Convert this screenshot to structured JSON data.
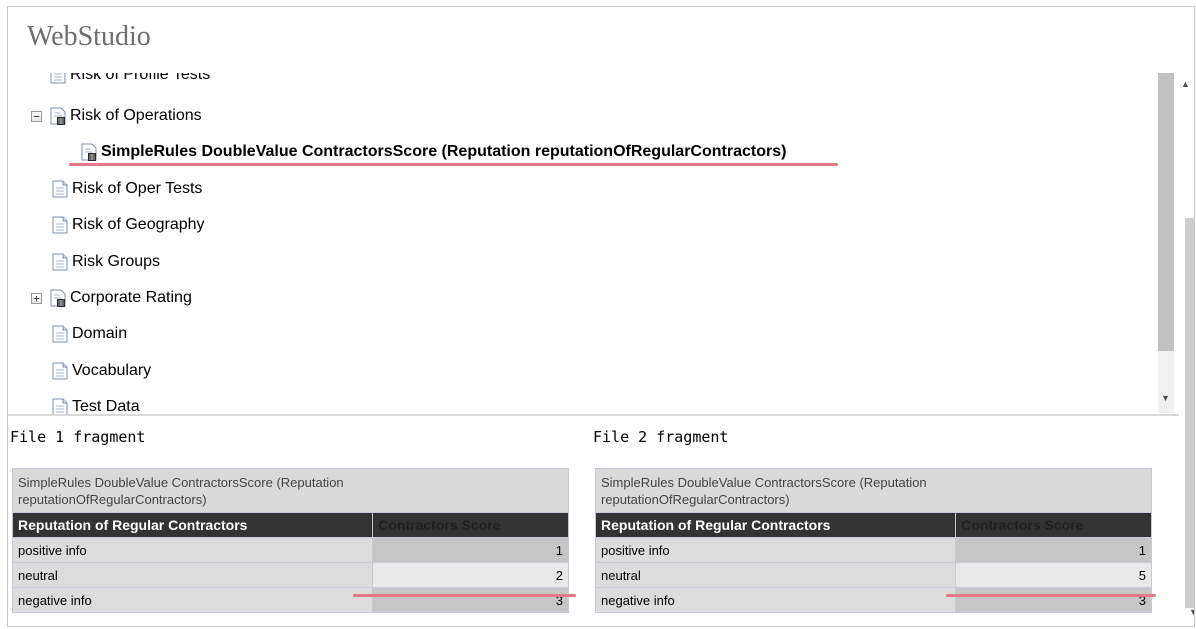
{
  "app": {
    "title": "WebStudio"
  },
  "tree": {
    "items": [
      {
        "label": "Risk of Profile Tests",
        "icon": "document-icon",
        "toggle": null
      },
      {
        "label": "Risk of Operations",
        "icon": "table-document-icon",
        "toggle": "−"
      },
      {
        "label": "SimpleRules DoubleValue ContractorsScore (Reputation reputationOfRegularContractors)",
        "icon": "table-document-icon",
        "toggle": null,
        "selected": true
      },
      {
        "label": "Risk of Oper Tests",
        "icon": "document-icon",
        "toggle": null
      },
      {
        "label": "Risk of Geography",
        "icon": "document-icon",
        "toggle": null
      },
      {
        "label": "Risk Groups",
        "icon": "document-icon",
        "toggle": null
      },
      {
        "label": "Corporate Rating",
        "icon": "table-document-icon",
        "toggle": "+"
      },
      {
        "label": "Domain",
        "icon": "document-icon",
        "toggle": null
      },
      {
        "label": "Vocabulary",
        "icon": "document-icon",
        "toggle": null
      },
      {
        "label": "Test Data",
        "icon": "document-icon",
        "toggle": null
      }
    ]
  },
  "compare": {
    "file1": {
      "title": "File 1 fragment",
      "table": {
        "caption_line1": "SimpleRules DoubleValue ContractorsScore (Reputation",
        "caption_line2": "reputationOfRegularContractors)",
        "headers": [
          "Reputation of Regular Contractors",
          "Contractors Score"
        ],
        "rows": [
          {
            "label": "positive info",
            "value": "1"
          },
          {
            "label": "neutral",
            "value": "2"
          },
          {
            "label": "negative info",
            "value": "3"
          }
        ]
      }
    },
    "file2": {
      "title": "File 2 fragment",
      "table": {
        "caption_line1": "SimpleRules DoubleValue ContractorsScore (Reputation",
        "caption_line2": "reputationOfRegularContractors)",
        "headers": [
          "Reputation of Regular Contractors",
          "Contractors Score"
        ],
        "rows": [
          {
            "label": "positive info",
            "value": "1"
          },
          {
            "label": "neutral",
            "value": "5"
          },
          {
            "label": "negative info",
            "value": "3"
          }
        ]
      }
    }
  },
  "colors": {
    "highlight_underline": "#e27a86",
    "table_header": "#333333"
  }
}
